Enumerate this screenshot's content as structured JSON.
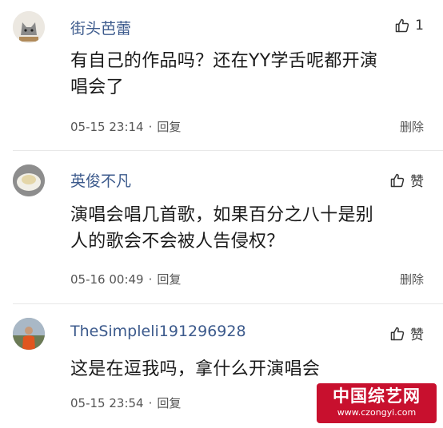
{
  "comments": [
    {
      "username": "街头芭蕾",
      "body_lines": [
        "有自己的作品吗？还在YY学舌呢都开演",
        "唱会了"
      ],
      "time": "05-15 23:14",
      "reply_label": "回复",
      "like_label": "1",
      "delete_label": "删除",
      "avatar": "cat-avatar"
    },
    {
      "username": "英俊不凡",
      "body_lines": [
        "演唱会唱几首歌，如果百分之八十是别",
        "人的歌会不会被人告侵权？"
      ],
      "time": "05-16 00:49",
      "reply_label": "回复",
      "like_label": "赞",
      "delete_label": "删除",
      "avatar": "bowl-avatar"
    },
    {
      "username": "TheSimpleli191296928",
      "body_lines": [
        "这是在逗我吗，拿什么开演唱会"
      ],
      "time": "05-15 23:54",
      "reply_label": "回复",
      "like_label": "赞",
      "avatar": "person-avatar"
    }
  ],
  "separator": "·",
  "watermark": {
    "title": "中国综艺网",
    "url": "www.czongyi.com"
  },
  "colors": {
    "username": "#3c5a8c",
    "text": "#1a1a1a",
    "meta": "#555555",
    "watermark": "#c8102e"
  }
}
